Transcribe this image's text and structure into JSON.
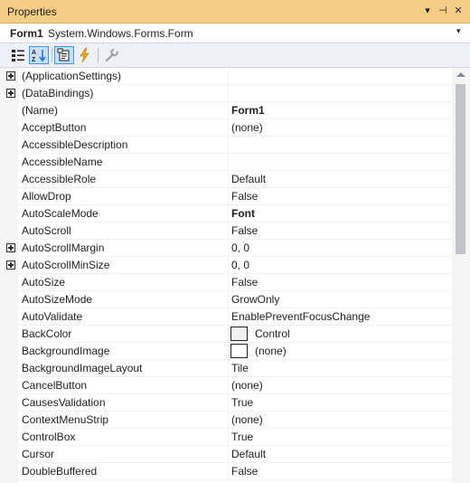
{
  "panel": {
    "title": "Properties",
    "dropdown_glyph": "▾",
    "pin_glyph": "⊣",
    "close_glyph": "✕"
  },
  "object_selector": {
    "name": "Form1",
    "type": "System.Windows.Forms.Form",
    "chevron": "▾"
  },
  "toolbar": {
    "buttons": [
      {
        "name": "categorized-icon",
        "active": false
      },
      {
        "name": "alphabetical-icon",
        "active": true
      },
      {
        "name": "properties-icon",
        "active": true
      },
      {
        "name": "events-icon",
        "active": false
      },
      {
        "name": "property-pages-icon",
        "active": false
      }
    ]
  },
  "properties": [
    {
      "name": "(ApplicationSettings)",
      "value": "",
      "expandable": true
    },
    {
      "name": "(DataBindings)",
      "value": "",
      "expandable": true
    },
    {
      "name": "(Name)",
      "value": "Form1",
      "bold": true
    },
    {
      "name": "AcceptButton",
      "value": "(none)"
    },
    {
      "name": "AccessibleDescription",
      "value": ""
    },
    {
      "name": "AccessibleName",
      "value": ""
    },
    {
      "name": "AccessibleRole",
      "value": "Default"
    },
    {
      "name": "AllowDrop",
      "value": "False"
    },
    {
      "name": "AutoScaleMode",
      "value": "Font",
      "bold": true
    },
    {
      "name": "AutoScroll",
      "value": "False"
    },
    {
      "name": "AutoScrollMargin",
      "value": "0, 0",
      "expandable": true
    },
    {
      "name": "AutoScrollMinSize",
      "value": "0, 0",
      "expandable": true
    },
    {
      "name": "AutoSize",
      "value": "False"
    },
    {
      "name": "AutoSizeMode",
      "value": "GrowOnly"
    },
    {
      "name": "AutoValidate",
      "value": "EnablePreventFocusChange"
    },
    {
      "name": "BackColor",
      "value": "Control",
      "swatch": "#f0f0f0"
    },
    {
      "name": "BackgroundImage",
      "value": "(none)",
      "swatch": "#ffffff"
    },
    {
      "name": "BackgroundImageLayout",
      "value": "Tile"
    },
    {
      "name": "CancelButton",
      "value": "(none)"
    },
    {
      "name": "CausesValidation",
      "value": "True"
    },
    {
      "name": "ContextMenuStrip",
      "value": "(none)"
    },
    {
      "name": "ControlBox",
      "value": "True"
    },
    {
      "name": "Cursor",
      "value": "Default"
    },
    {
      "name": "DoubleBuffered",
      "value": "False"
    }
  ],
  "colors": {
    "title_bar": "#f5cc84",
    "toolbar": "#eef0f5",
    "active_button": "#c9ddf3",
    "scroll_thumb": "#c2c3c9"
  }
}
